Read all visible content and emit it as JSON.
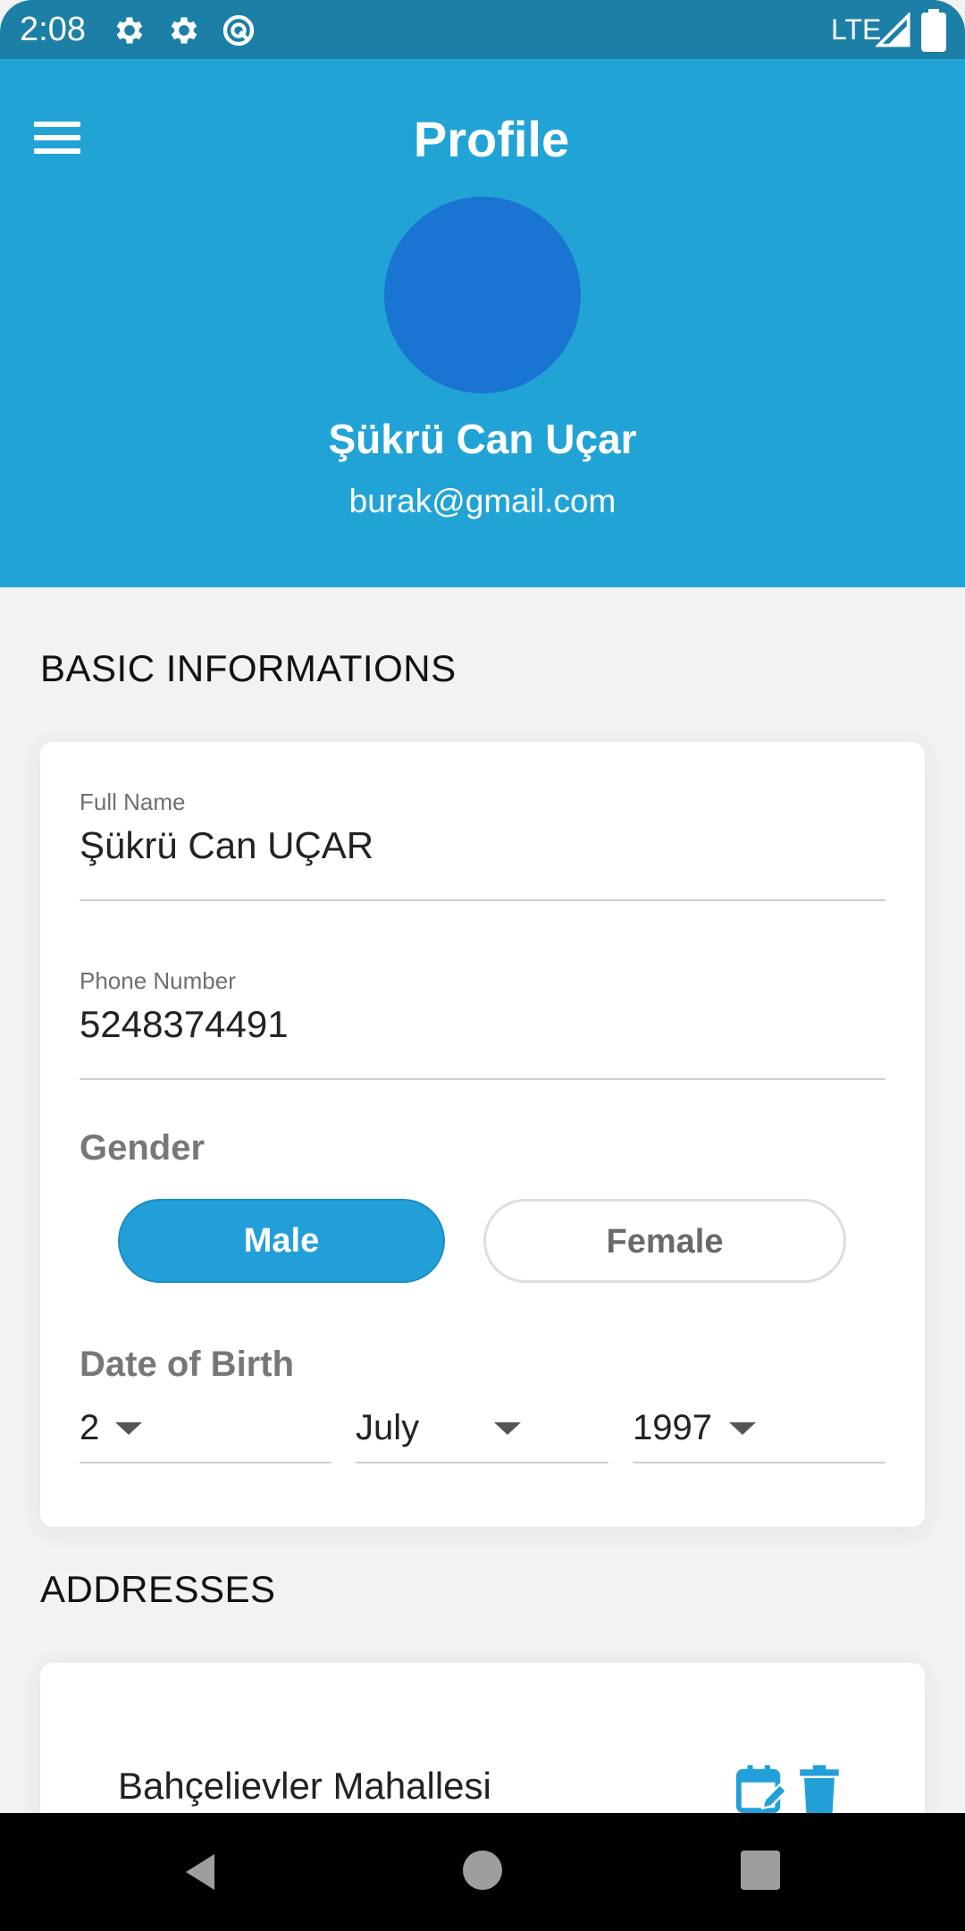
{
  "status_bar": {
    "time": "2:08",
    "network": "LTE",
    "icons": [
      "settings-icon",
      "settings-icon",
      "app-notification-icon",
      "signal-icon",
      "battery-icon"
    ]
  },
  "header": {
    "title": "Profile",
    "menu_icon": "hamburger-menu-icon",
    "user_name": "Şükrü Can Uçar",
    "user_email": "burak@gmail.com"
  },
  "basic_info": {
    "section_title": "BASIC INFORMATIONS",
    "full_name_label": "Full Name",
    "full_name_value": "Şükrü Can UÇAR",
    "phone_label": "Phone Number",
    "phone_value": "5248374491",
    "gender_label": "Gender",
    "gender_options": [
      "Male",
      "Female"
    ],
    "gender_selected": "Male",
    "dob_label": "Date of Birth",
    "dob_day": "2",
    "dob_month": "July",
    "dob_year": "1997"
  },
  "addresses": {
    "section_title": "ADDRESSES",
    "items": [
      {
        "text": "Bahçelievler Mahallesi",
        "edit_icon": "edit-calendar-icon",
        "delete_icon": "trash-icon"
      }
    ]
  },
  "colors": {
    "status_bar": "#1c7fa6",
    "header": "#22a3d6",
    "avatar": "#1a74d2",
    "accent": "#229fd8",
    "background": "#f2f2f2"
  },
  "nav_bar": {
    "icons": [
      "back-icon",
      "home-icon",
      "recents-icon"
    ]
  }
}
